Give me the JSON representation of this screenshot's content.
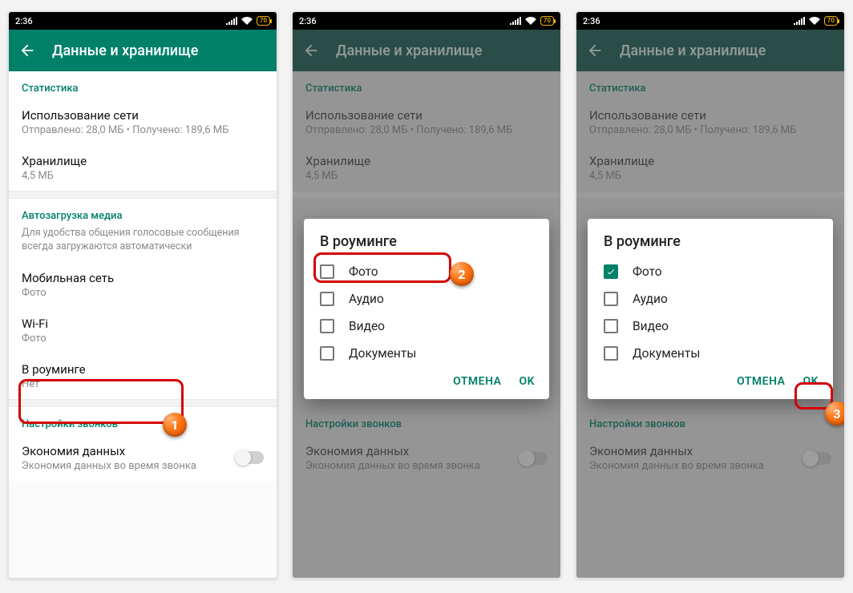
{
  "status": {
    "time": "2:36",
    "battery_pct": "70"
  },
  "appbar": {
    "title": "Данные и хранилище"
  },
  "sections": {
    "stats_header": "Статистика",
    "network_usage": {
      "label": "Использование сети",
      "sub": "Отправлено: 28,0 МБ • Получено: 189,6 МБ"
    },
    "storage": {
      "label": "Хранилище",
      "sub": "4,5 МБ"
    },
    "autoload_header": "Автозагрузка медиа",
    "autoload_note": "Для удобства общения голосовые сообщения всегда загружаются автоматически",
    "mobile": {
      "label": "Мобильная сеть",
      "sub": "Фото"
    },
    "wifi": {
      "label": "Wi-Fi",
      "sub": "Фото"
    },
    "roaming": {
      "label": "В роуминге",
      "sub": "Нет"
    },
    "calls_header": "Настройки звонков",
    "data_saver": {
      "label": "Экономия данных",
      "sub": "Экономия данных во время звонка"
    }
  },
  "dialog": {
    "title": "В роуминге",
    "options": {
      "photo": "Фото",
      "audio": "Аудио",
      "video": "Видео",
      "docs": "Документы"
    },
    "cancel": "ОТМЕНА",
    "ok": "OK"
  },
  "badges": {
    "b1": "1",
    "b2": "2",
    "b3": "3"
  }
}
